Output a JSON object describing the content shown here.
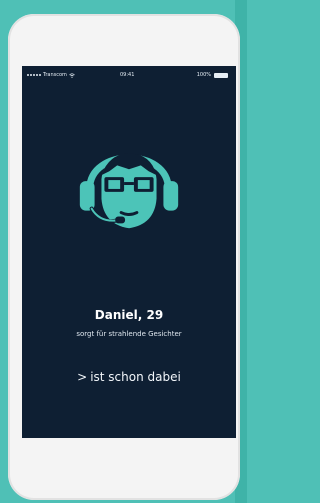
{
  "statusbar": {
    "carrier": "Transcom",
    "time": "09:41",
    "battery": "100%"
  },
  "profile": {
    "name": "Daniel, 29",
    "tagline": "sorgt für strahlende Gesichter"
  },
  "cta": {
    "chevron": ">",
    "label": "ist schon dabei"
  },
  "colors": {
    "background": "#4fc0b6",
    "screen": "#0e1f33",
    "accent": "#4cc4b8"
  },
  "icons": {
    "avatar": "headset-support-agent-icon",
    "wifi": "wifi-icon",
    "battery": "battery-icon"
  }
}
